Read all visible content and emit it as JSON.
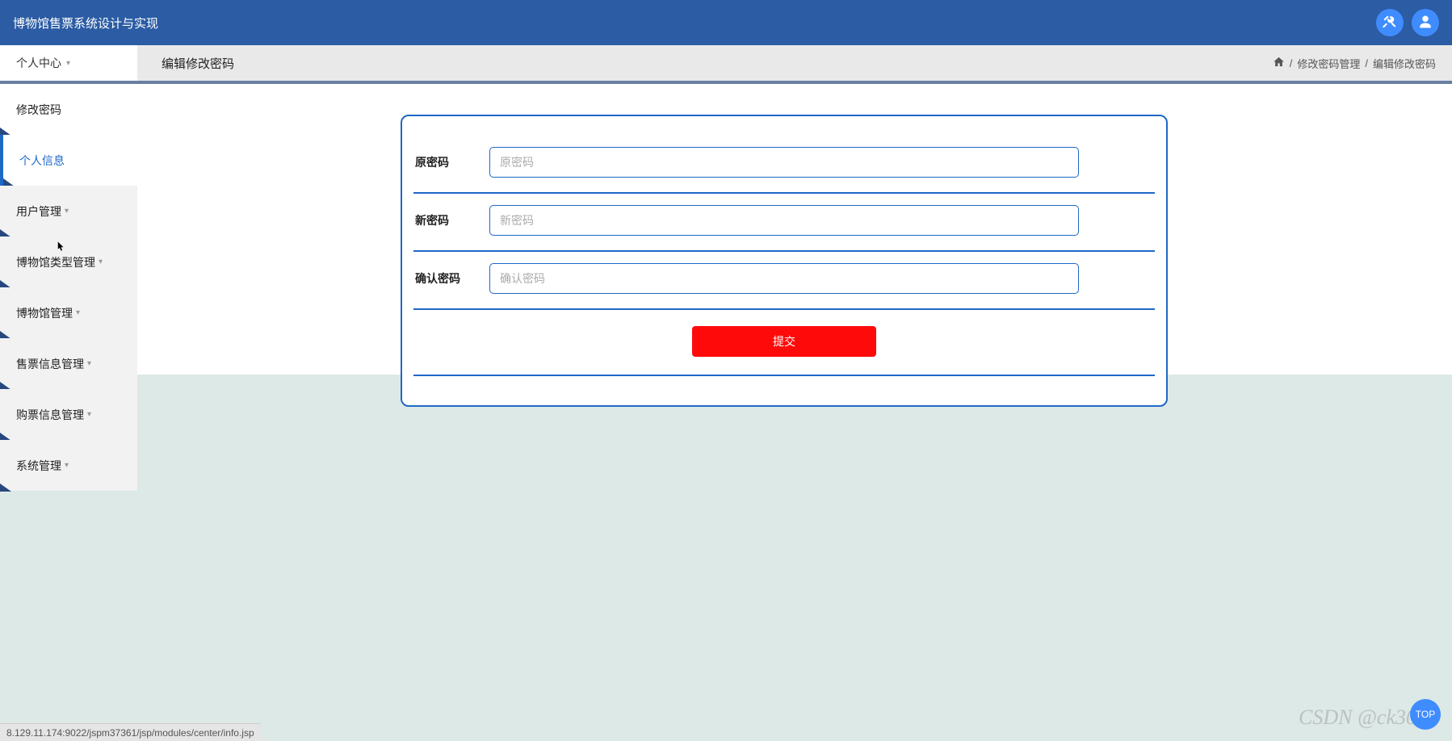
{
  "header": {
    "title": "博物馆售票系统设计与实现"
  },
  "subheader": {
    "left_label": "个人中心",
    "page_title": "编辑修改密码"
  },
  "breadcrumb": {
    "sep": "/",
    "item1": "修改密码管理",
    "item2": "编辑修改密码"
  },
  "sidebar": {
    "items": [
      {
        "label": "修改密码",
        "has_caret": false,
        "active": false,
        "white": true
      },
      {
        "label": "个人信息",
        "has_caret": false,
        "active": true,
        "white": true
      },
      {
        "label": "用户管理",
        "has_caret": true,
        "active": false,
        "white": false
      },
      {
        "label": "博物馆类型管理",
        "has_caret": true,
        "active": false,
        "white": false
      },
      {
        "label": "博物馆管理",
        "has_caret": true,
        "active": false,
        "white": false
      },
      {
        "label": "售票信息管理",
        "has_caret": true,
        "active": false,
        "white": false
      },
      {
        "label": "购票信息管理",
        "has_caret": true,
        "active": false,
        "white": false
      },
      {
        "label": "系统管理",
        "has_caret": true,
        "active": false,
        "white": false
      }
    ]
  },
  "form": {
    "rows": [
      {
        "label": "原密码",
        "placeholder": "原密码"
      },
      {
        "label": "新密码",
        "placeholder": "新密码"
      },
      {
        "label": "确认密码",
        "placeholder": "确认密码"
      }
    ],
    "submit_label": "提交"
  },
  "status_bar": {
    "text": "8.129.11.174:9022/jspm37361/jsp/modules/center/info.jsp"
  },
  "watermark": {
    "text": "CSDN @ck3013"
  },
  "fab": {
    "text": "TOP"
  }
}
